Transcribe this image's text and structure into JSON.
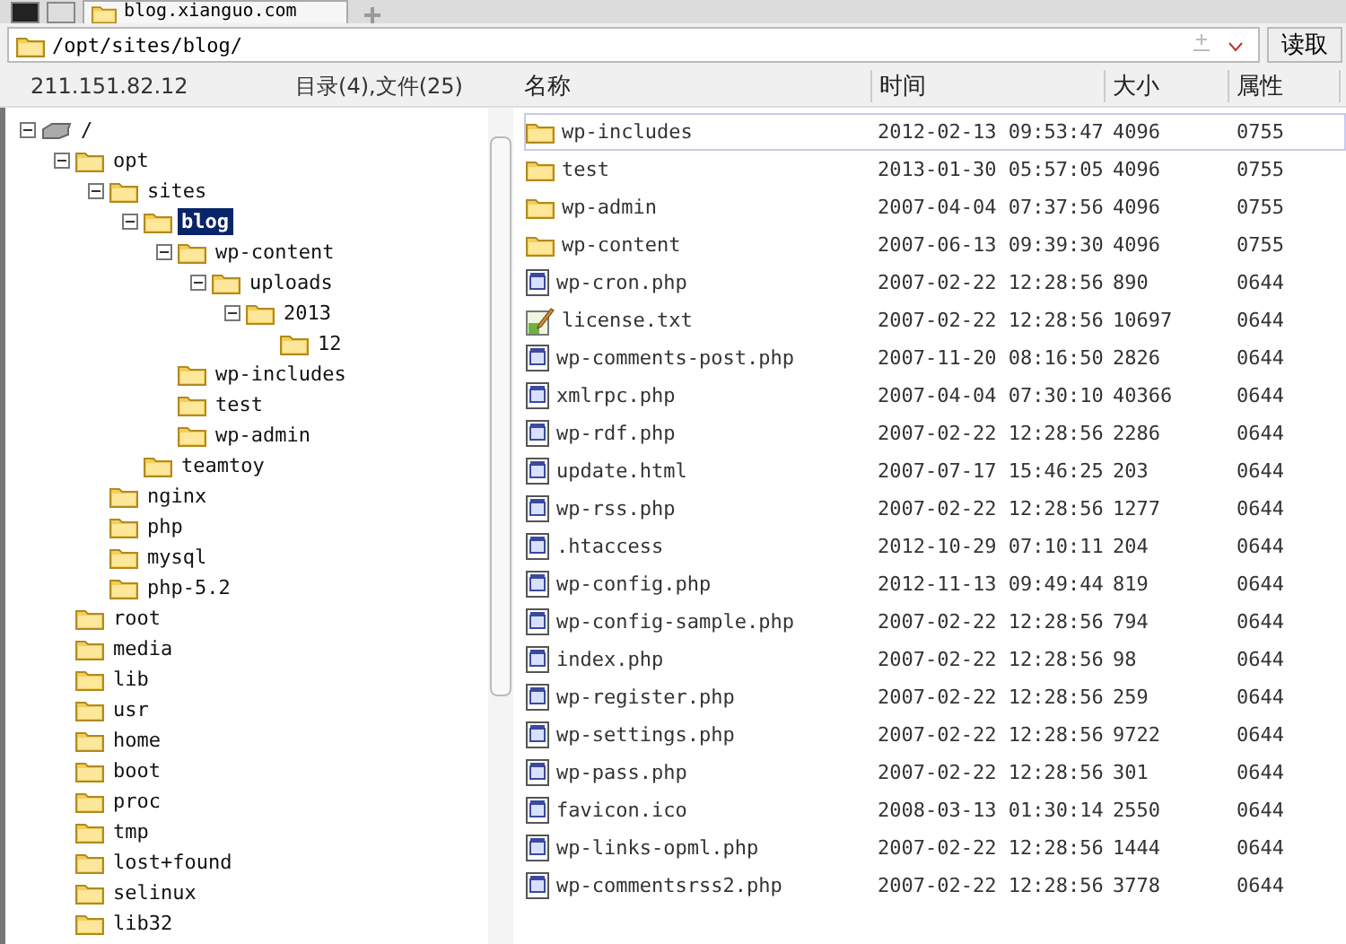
{
  "tabs": [
    {
      "label": "blog.xianguo.com",
      "selected": true
    }
  ],
  "address": {
    "value": "/opt/sites/blog/",
    "button": "读取"
  },
  "info": {
    "host": "211.151.82.12",
    "counts": "目录(4),文件(25)"
  },
  "columns": [
    "名称",
    "时间",
    "大小",
    "属性"
  ],
  "tree": [
    {
      "name": "/",
      "kind": "drive",
      "expanded": true,
      "selected": false,
      "children": [
        {
          "name": "opt",
          "kind": "folder",
          "expanded": true,
          "selected": false,
          "children": [
            {
              "name": "sites",
              "kind": "folder",
              "expanded": true,
              "selected": false,
              "children": [
                {
                  "name": "blog",
                  "kind": "folder",
                  "expanded": true,
                  "selected": true,
                  "children": [
                    {
                      "name": "wp-content",
                      "kind": "folder",
                      "expanded": true,
                      "selected": false,
                      "children": [
                        {
                          "name": "uploads",
                          "kind": "folder",
                          "expanded": true,
                          "selected": false,
                          "children": [
                            {
                              "name": "2013",
                              "kind": "folder",
                              "expanded": true,
                              "selected": false,
                              "children": [
                                {
                                  "name": "12",
                                  "kind": "folder",
                                  "selected": false
                                }
                              ]
                            }
                          ]
                        }
                      ]
                    },
                    {
                      "name": "wp-includes",
                      "kind": "folder",
                      "selected": false
                    },
                    {
                      "name": "test",
                      "kind": "folder",
                      "selected": false
                    },
                    {
                      "name": "wp-admin",
                      "kind": "folder",
                      "selected": false
                    }
                  ]
                },
                {
                  "name": "teamtoy",
                  "kind": "folder",
                  "selected": false
                }
              ]
            },
            {
              "name": "nginx",
              "kind": "folder",
              "selected": false
            },
            {
              "name": "php",
              "kind": "folder",
              "selected": false
            },
            {
              "name": "mysql",
              "kind": "folder",
              "selected": false
            },
            {
              "name": "php-5.2",
              "kind": "folder",
              "selected": false
            }
          ]
        },
        {
          "name": "root",
          "kind": "folder",
          "selected": false
        },
        {
          "name": "media",
          "kind": "folder",
          "selected": false
        },
        {
          "name": "lib",
          "kind": "folder",
          "selected": false
        },
        {
          "name": "usr",
          "kind": "folder",
          "selected": false
        },
        {
          "name": "home",
          "kind": "folder",
          "selected": false
        },
        {
          "name": "boot",
          "kind": "folder",
          "selected": false
        },
        {
          "name": "proc",
          "kind": "folder",
          "selected": false
        },
        {
          "name": "tmp",
          "kind": "folder",
          "selected": false
        },
        {
          "name": "lost+found",
          "kind": "folder",
          "selected": false
        },
        {
          "name": "selinux",
          "kind": "folder",
          "selected": false
        },
        {
          "name": "lib32",
          "kind": "folder",
          "selected": false
        }
      ]
    }
  ],
  "files": [
    {
      "kind": "folder",
      "name": "wp-includes",
      "time": "2012-02-13 09:53:47",
      "size": "4096",
      "mode": "0755",
      "selected": true
    },
    {
      "kind": "folder",
      "name": "test",
      "time": "2013-01-30 05:57:05",
      "size": "4096",
      "mode": "0755",
      "selected": false
    },
    {
      "kind": "folder",
      "name": "wp-admin",
      "time": "2007-04-04 07:37:56",
      "size": "4096",
      "mode": "0755",
      "selected": false
    },
    {
      "kind": "folder",
      "name": "wp-content",
      "time": "2007-06-13 09:39:30",
      "size": "4096",
      "mode": "0755",
      "selected": false
    },
    {
      "kind": "file",
      "name": "wp-cron.php",
      "time": "2007-02-22 12:28:56",
      "size": "890",
      "mode": "0644",
      "selected": false
    },
    {
      "kind": "text",
      "name": "license.txt",
      "time": "2007-02-22 12:28:56",
      "size": "10697",
      "mode": "0644",
      "selected": false
    },
    {
      "kind": "file",
      "name": "wp-comments-post.php",
      "time": "2007-11-20 08:16:50",
      "size": "2826",
      "mode": "0644",
      "selected": false
    },
    {
      "kind": "file",
      "name": "xmlrpc.php",
      "time": "2007-04-04 07:30:10",
      "size": "40366",
      "mode": "0644",
      "selected": false
    },
    {
      "kind": "file",
      "name": "wp-rdf.php",
      "time": "2007-02-22 12:28:56",
      "size": "2286",
      "mode": "0644",
      "selected": false
    },
    {
      "kind": "file",
      "name": "update.html",
      "time": "2007-07-17 15:46:25",
      "size": "203",
      "mode": "0644",
      "selected": false
    },
    {
      "kind": "file",
      "name": "wp-rss.php",
      "time": "2007-02-22 12:28:56",
      "size": "1277",
      "mode": "0644",
      "selected": false
    },
    {
      "kind": "file",
      "name": ".htaccess",
      "time": "2012-10-29 07:10:11",
      "size": "204",
      "mode": "0644",
      "selected": false
    },
    {
      "kind": "file",
      "name": "wp-config.php",
      "time": "2012-11-13 09:49:44",
      "size": "819",
      "mode": "0644",
      "selected": false
    },
    {
      "kind": "file",
      "name": "wp-config-sample.php",
      "time": "2007-02-22 12:28:56",
      "size": "794",
      "mode": "0644",
      "selected": false
    },
    {
      "kind": "file",
      "name": "index.php",
      "time": "2007-02-22 12:28:56",
      "size": "98",
      "mode": "0644",
      "selected": false
    },
    {
      "kind": "file",
      "name": "wp-register.php",
      "time": "2007-02-22 12:28:56",
      "size": "259",
      "mode": "0644",
      "selected": false
    },
    {
      "kind": "file",
      "name": "wp-settings.php",
      "time": "2007-02-22 12:28:56",
      "size": "9722",
      "mode": "0644",
      "selected": false
    },
    {
      "kind": "file",
      "name": "wp-pass.php",
      "time": "2007-02-22 12:28:56",
      "size": "301",
      "mode": "0644",
      "selected": false
    },
    {
      "kind": "file",
      "name": "favicon.ico",
      "time": "2008-03-13 01:30:14",
      "size": "2550",
      "mode": "0644",
      "selected": false
    },
    {
      "kind": "file",
      "name": "wp-links-opml.php",
      "time": "2007-02-22 12:28:56",
      "size": "1444",
      "mode": "0644",
      "selected": false
    },
    {
      "kind": "file",
      "name": "wp-commentsrss2.php",
      "time": "2007-02-22 12:28:56",
      "size": "3778",
      "mode": "0644",
      "selected": false
    }
  ]
}
